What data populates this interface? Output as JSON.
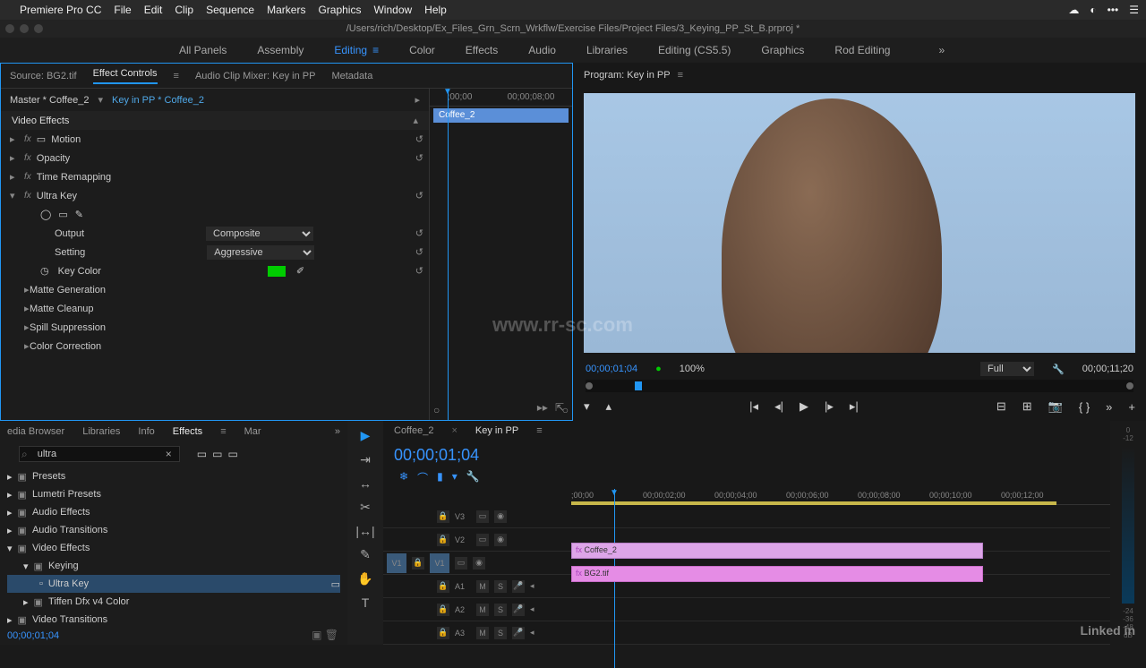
{
  "menubar": {
    "app": "Premiere Pro CC",
    "items": [
      "File",
      "Edit",
      "Clip",
      "Sequence",
      "Markers",
      "Graphics",
      "Window",
      "Help"
    ]
  },
  "titlebar": "/Users/rich/Desktop/Ex_Files_Grn_Scrn_Wrkflw/Exercise Files/Project Files/3_Keying_PP_St_B.prproj *",
  "workspaces": [
    "All Panels",
    "Assembly",
    "Editing",
    "Color",
    "Effects",
    "Audio",
    "Libraries",
    "Editing (CS5.5)",
    "Graphics",
    "Rod Editing"
  ],
  "workspace_active": "Editing",
  "ec_tabs": {
    "source": "Source: BG2.tif",
    "effect_controls": "Effect Controls",
    "mixer": "Audio Clip Mixer: Key in PP",
    "metadata": "Metadata"
  },
  "ec_master": "Master * Coffee_2",
  "ec_seq": "Key in PP * Coffee_2",
  "ec_clipname": "Coffee_2",
  "ec_tc_left": ";00;00",
  "ec_tc_right": "00;00;08;00",
  "video_effects_label": "Video Effects",
  "fx_rows": {
    "motion": "Motion",
    "opacity": "Opacity",
    "time_remap": "Time Remapping",
    "ultra_key": "Ultra Key",
    "output": "Output",
    "output_val": "Composite",
    "setting": "Setting",
    "setting_val": "Aggressive",
    "key_color": "Key Color",
    "matte_gen": "Matte Generation",
    "matte_clean": "Matte Cleanup",
    "spill": "Spill Suppression",
    "color_corr": "Color Correction"
  },
  "ec_current_tc": "00;00;01;04",
  "program": {
    "tab": "Program: Key in PP",
    "tc": "00;00;01;04",
    "zoom": "100%",
    "resolution": "Full",
    "duration": "00;00;11;20"
  },
  "left_tabs": [
    "edia Browser",
    "Libraries",
    "Info",
    "Effects",
    "Mar"
  ],
  "left_active": "Effects",
  "search_value": "ultra",
  "tree": {
    "presets": "Presets",
    "lumetri": "Lumetri Presets",
    "audio_fx": "Audio Effects",
    "audio_tr": "Audio Transitions",
    "video_fx": "Video Effects",
    "keying": "Keying",
    "ultra_key": "Ultra Key",
    "tiffen": "Tiffen Dfx v4 Color",
    "video_tr": "Video Transitions"
  },
  "timeline": {
    "tabs": [
      "Coffee_2",
      "Key in PP"
    ],
    "active_tab": "Key in PP",
    "tc": "00;00;01;04",
    "ruler": [
      ";00;00",
      "00;00;02;00",
      "00;00;04;00",
      "00;00;06;00",
      "00;00;08;00",
      "00;00;10;00",
      "00;00;12;00"
    ],
    "tracks": {
      "v3": "V3",
      "v2": "V2",
      "v1": "V1",
      "a1": "A1",
      "a2": "A2",
      "a3": "A3"
    },
    "clips": {
      "v2": "Coffee_2",
      "v1": "BG2.tif"
    }
  },
  "meters": [
    "0",
    "-12",
    "-24",
    "-36",
    "-48",
    "dB"
  ],
  "watermark": "www.rr-sc.com",
  "linkedin": "Linked in"
}
